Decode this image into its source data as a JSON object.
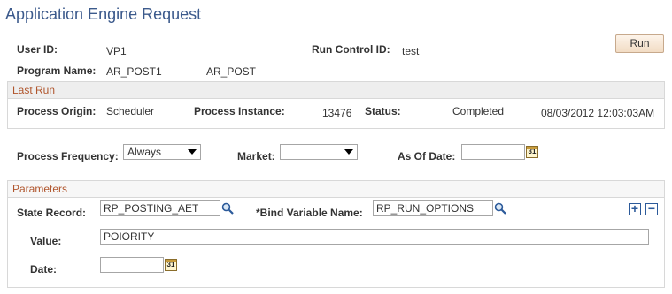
{
  "page": {
    "title": "Application Engine Request"
  },
  "header": {
    "user_id_label": "User ID:",
    "user_id": "VP1",
    "run_control_label": "Run Control ID:",
    "run_control": "test",
    "program_label": "Program Name:",
    "program_name": "AR_POST1",
    "program_desc": "AR_POST",
    "run_button": "Run"
  },
  "last_run": {
    "title": "Last Run",
    "origin_label": "Process Origin:",
    "origin": "Scheduler",
    "instance_label": "Process Instance:",
    "instance": "13476",
    "status_label": "Status:",
    "status": "Completed",
    "datetime": "08/03/2012 12:03:03AM"
  },
  "options": {
    "frequency_label": "Process Frequency:",
    "frequency": "Always",
    "market_label": "Market:",
    "market": "",
    "asof_label": "As Of Date:",
    "asof": ""
  },
  "parameters": {
    "title": "Parameters",
    "state_record_label": "State Record:",
    "state_record": "RP_POSTING_AET",
    "bind_label": "*Bind Variable Name:",
    "bind_value": "RP_RUN_OPTIONS",
    "value_label": "Value:",
    "value": "POIORITY",
    "date_label": "Date:",
    "date": ""
  },
  "icons": {
    "search": "magnifier-icon",
    "calendar": "calendar-icon",
    "add": "plus-icon",
    "remove": "minus-icon"
  },
  "colors": {
    "title": "#3c5a8c",
    "section_header": "#b0552c",
    "run_button_bg": "#f2dcc4"
  }
}
